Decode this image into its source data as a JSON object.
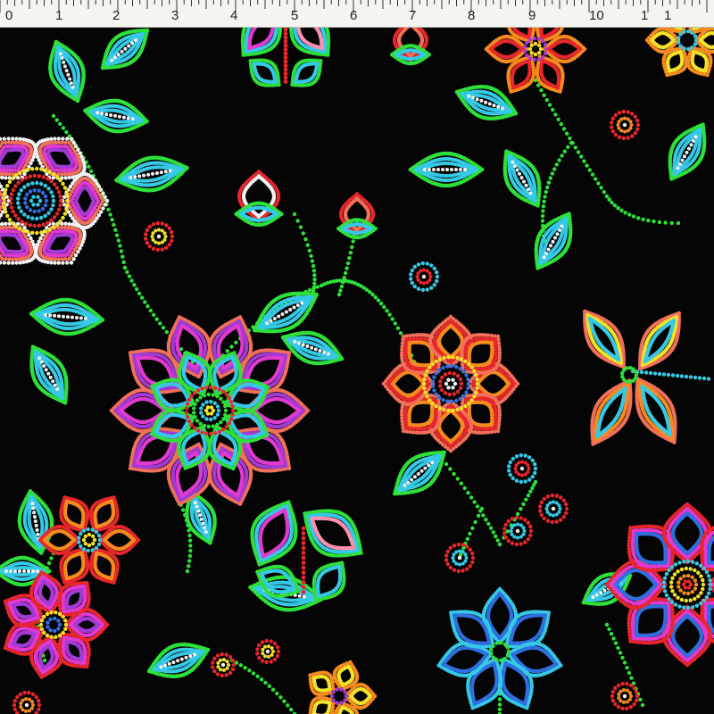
{
  "ruler": {
    "labels": [
      "0",
      "1",
      "2",
      "3",
      "4",
      "5",
      "6",
      "7",
      "8",
      "9",
      "10",
      "1",
      "1"
    ]
  },
  "palette": {
    "background": "#050505",
    "leaf_green": "#2ee03a",
    "turquoise": "#36c9e6",
    "white": "#f2f2f2",
    "red": "#e8262b",
    "coral": "#f2705a",
    "purple": "#a23ad6",
    "magenta": "#e23ad0",
    "yellow": "#f4e12a",
    "orange": "#f78a1f",
    "blue": "#2f6fe0",
    "pink": "#ff8fb0"
  },
  "motifs": [
    "flower-icon",
    "leaf-icon",
    "butterfly-icon",
    "dragonfly-icon",
    "rose-bud-icon",
    "tulip-icon",
    "berry-icon",
    "vine-icon"
  ]
}
